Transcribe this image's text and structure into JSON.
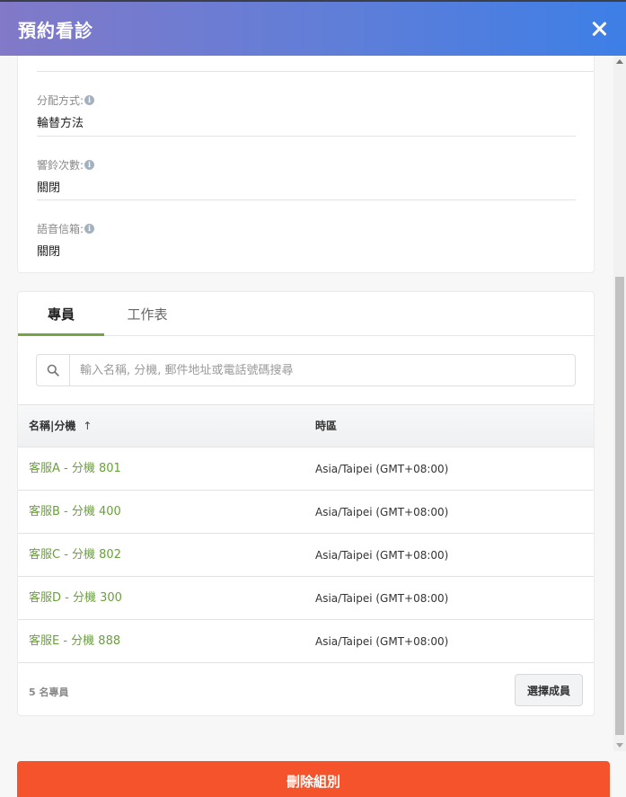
{
  "header": {
    "title": "預約看診"
  },
  "settings": {
    "fields": [
      {
        "label": "分配方式:",
        "value": "輪替方法"
      },
      {
        "label": "響鈴次數:",
        "value": "關閉"
      },
      {
        "label": "語音信箱:",
        "value": "關閉"
      }
    ]
  },
  "tabs": [
    {
      "label": "專員",
      "active": true
    },
    {
      "label": "工作表",
      "active": false
    }
  ],
  "search": {
    "placeholder": "輸入名稱, 分機, 郵件地址或電話號碼搜尋",
    "value": ""
  },
  "table": {
    "columns": [
      "名稱|分機",
      "時區"
    ],
    "sort_indicator": "↑",
    "rows": [
      {
        "name": "客服A - 分機 801",
        "timezone": "Asia/Taipei (GMT+08:00)"
      },
      {
        "name": "客服B - 分機 400",
        "timezone": "Asia/Taipei (GMT+08:00)"
      },
      {
        "name": "客服C - 分機 802",
        "timezone": "Asia/Taipei (GMT+08:00)"
      },
      {
        "name": "客服D - 分機 300",
        "timezone": "Asia/Taipei (GMT+08:00)"
      },
      {
        "name": "客服E - 分機 888",
        "timezone": "Asia/Taipei (GMT+08:00)"
      }
    ]
  },
  "footer": {
    "count_label": "5 名專員",
    "select_label": "選擇成員"
  },
  "delete_label": "刪除組別",
  "colors": {
    "accent_green": "#6aa13a",
    "delete_red": "#f4532b",
    "header_start": "#8279c8",
    "header_end": "#3d7fe6"
  },
  "icons": {
    "close": "close-icon",
    "info": "info-icon",
    "search": "search-icon",
    "sort": "sort-ascending-icon"
  }
}
